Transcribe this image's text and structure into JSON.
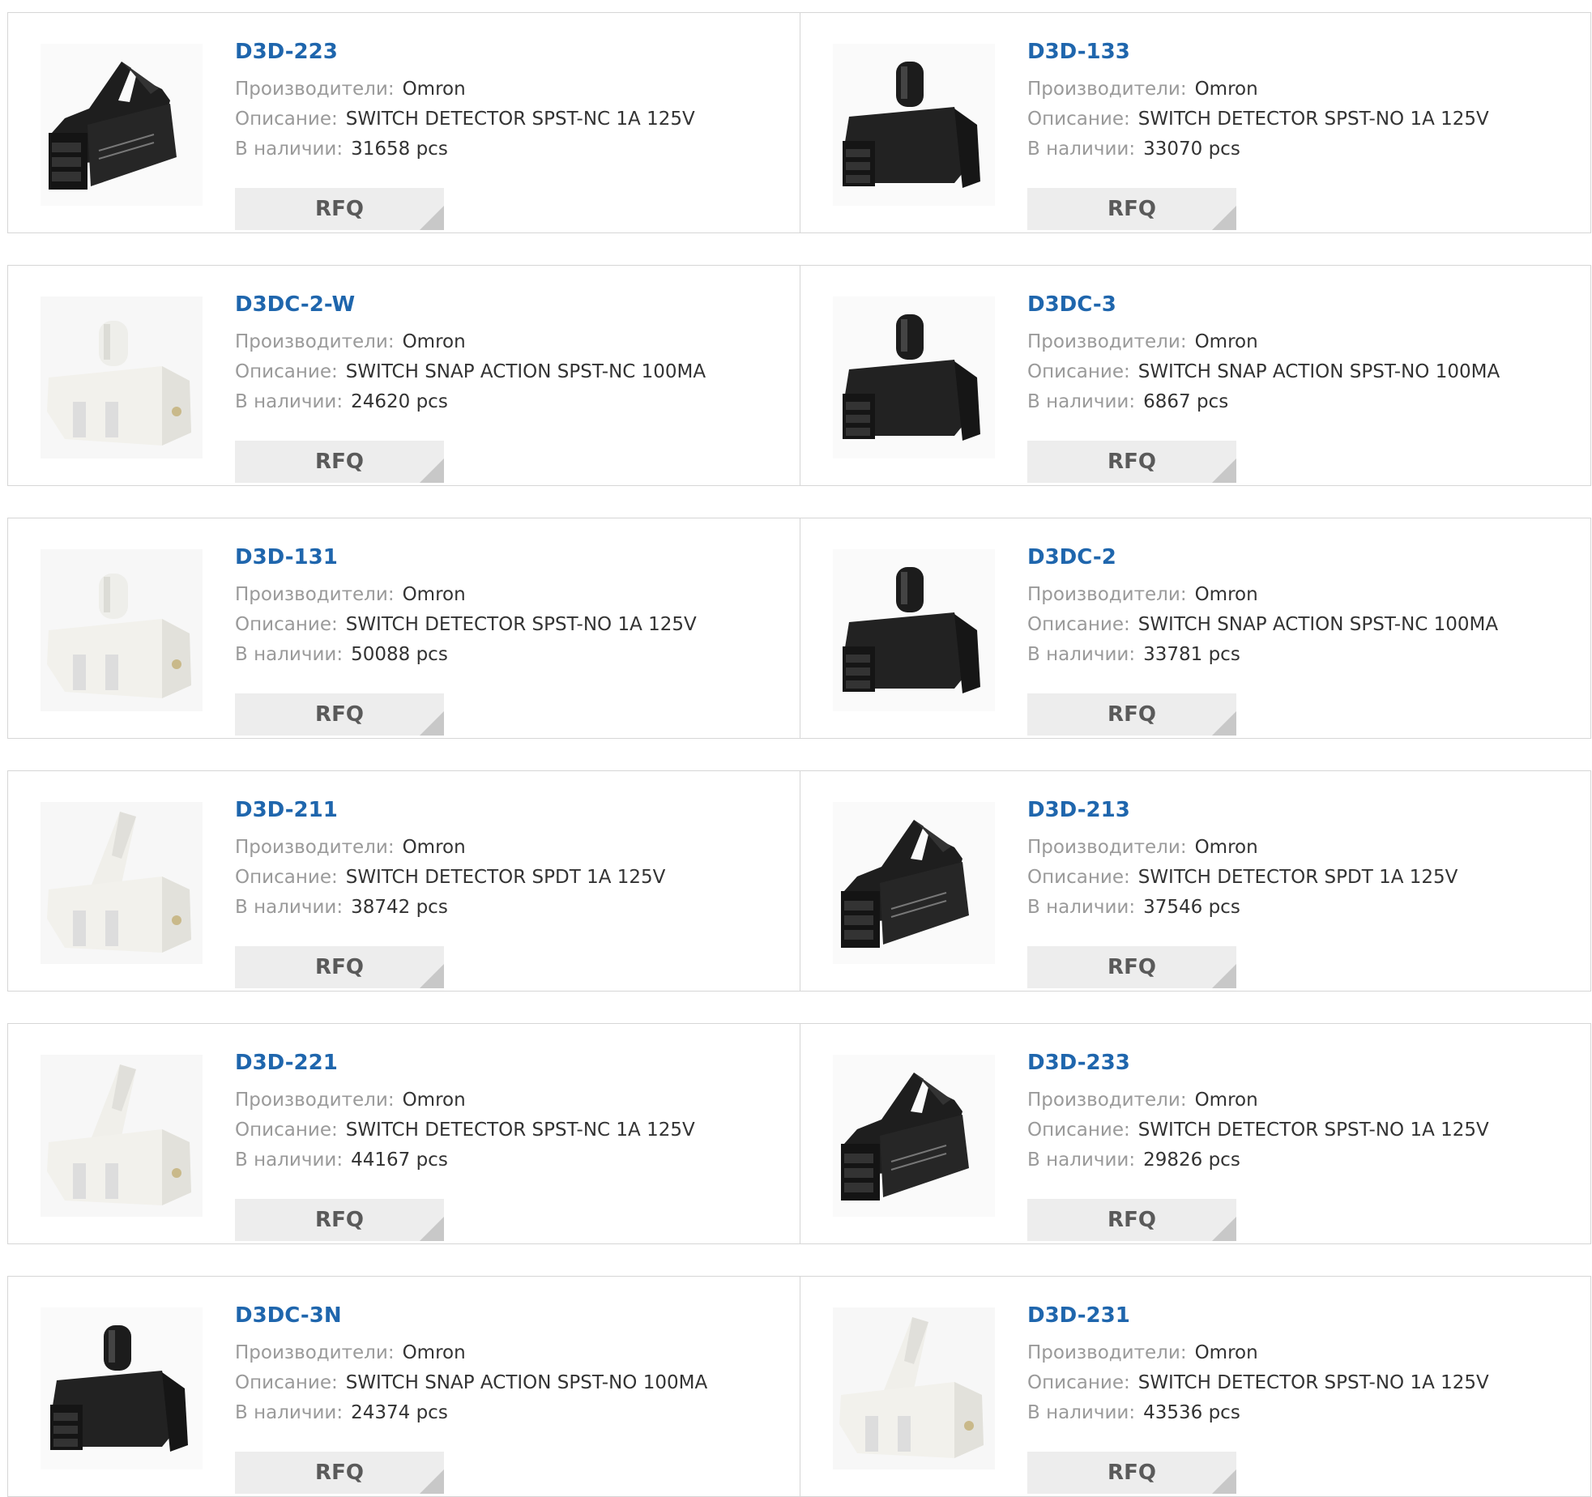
{
  "labels": {
    "manufacturer": "Производители:",
    "description": "Описание:",
    "stock": "В наличии:",
    "rfq": "RFQ"
  },
  "products": [
    {
      "name": "D3D-223",
      "manufacturer": "Omron",
      "description": "SWITCH DETECTOR SPST-NC 1A 125V",
      "stock": "31658 pcs",
      "image": "black-lever-switch-icon"
    },
    {
      "name": "D3D-133",
      "manufacturer": "Omron",
      "description": "SWITCH DETECTOR SPST-NO 1A 125V",
      "stock": "33070 pcs",
      "image": "black-plunger-switch-icon"
    },
    {
      "name": "D3DC-2-W",
      "manufacturer": "Omron",
      "description": "SWITCH SNAP ACTION SPST-NC 100MA",
      "stock": "24620 pcs",
      "image": "white-plunger-switch-icon"
    },
    {
      "name": "D3DC-3",
      "manufacturer": "Omron",
      "description": "SWITCH SNAP ACTION SPST-NO 100MA",
      "stock": "6867 pcs",
      "image": "black-plunger-switch-icon"
    },
    {
      "name": "D3D-131",
      "manufacturer": "Omron",
      "description": "SWITCH DETECTOR SPST-NO 1A 125V",
      "stock": "50088 pcs",
      "image": "white-plunger-switch-icon"
    },
    {
      "name": "D3DC-2",
      "manufacturer": "Omron",
      "description": "SWITCH SNAP ACTION SPST-NC 100MA",
      "stock": "33781 pcs",
      "image": "black-plunger-switch-icon"
    },
    {
      "name": "D3D-211",
      "manufacturer": "Omron",
      "description": "SWITCH DETECTOR SPDT 1A 125V",
      "stock": "38742 pcs",
      "image": "white-lever-switch-icon"
    },
    {
      "name": "D3D-213",
      "manufacturer": "Omron",
      "description": "SWITCH DETECTOR SPDT 1A 125V",
      "stock": "37546 pcs",
      "image": "black-lever-switch-icon"
    },
    {
      "name": "D3D-221",
      "manufacturer": "Omron",
      "description": "SWITCH DETECTOR SPST-NC 1A 125V",
      "stock": "44167 pcs",
      "image": "white-lever-switch-icon"
    },
    {
      "name": "D3D-233",
      "manufacturer": "Omron",
      "description": "SWITCH DETECTOR SPST-NO 1A 125V",
      "stock": "29826 pcs",
      "image": "black-lever-switch-icon"
    },
    {
      "name": "D3DC-3N",
      "manufacturer": "Omron",
      "description": "SWITCH SNAP ACTION SPST-NO 100MA",
      "stock": "24374 pcs",
      "image": "black-plunger-switch-icon"
    },
    {
      "name": "D3D-231",
      "manufacturer": "Omron",
      "description": "SWITCH DETECTOR SPST-NO 1A 125V",
      "stock": "43536 pcs",
      "image": "white-lever-switch-icon"
    }
  ]
}
